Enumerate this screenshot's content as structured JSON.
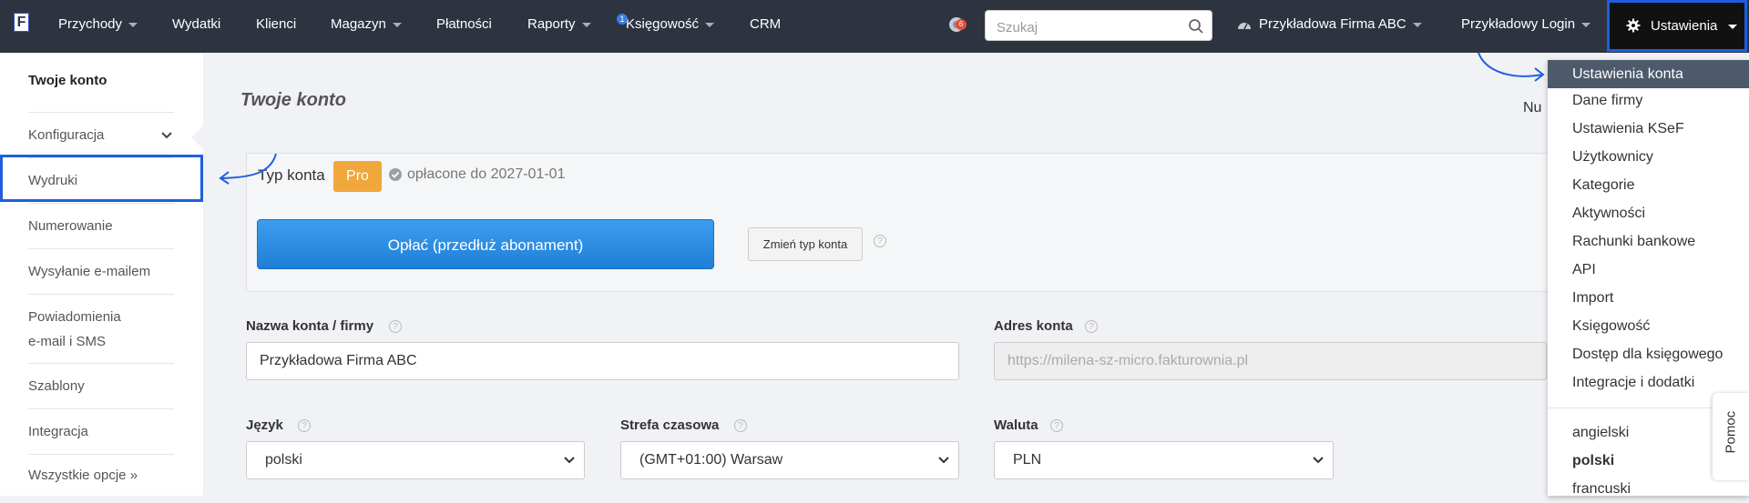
{
  "nav": {
    "logo": "F",
    "items": [
      {
        "label": "Przychody",
        "caret": true
      },
      {
        "label": "Wydatki",
        "caret": false
      },
      {
        "label": "Klienci",
        "caret": false
      },
      {
        "label": "Magazyn",
        "caret": true
      },
      {
        "label": "Płatności",
        "caret": false
      },
      {
        "label": "Raporty",
        "caret": true
      },
      {
        "label": "Księgowość",
        "caret": true,
        "badge": "1"
      },
      {
        "label": "CRM",
        "caret": false
      }
    ],
    "notification_count": "6",
    "search_placeholder": "Szukaj",
    "company": "Przykładowa Firma ABC",
    "login": "Przykładowy Login",
    "settings": "Ustawienia"
  },
  "sidebar": {
    "items": [
      {
        "label": "Twoje konto",
        "active": true
      },
      {
        "label": "Konfiguracja",
        "chevron": true
      },
      {
        "label": "Wydruki"
      },
      {
        "label": "Numerowanie"
      },
      {
        "label": "Wysyłanie e-mailem"
      },
      {
        "label": "Powiadomienia",
        "label2": "e-mail i SMS"
      },
      {
        "label": "Szablony"
      },
      {
        "label": "Integracja"
      },
      {
        "label": "Wszystkie opcje »"
      }
    ]
  },
  "main": {
    "title": "Twoje konto",
    "num_label": "Nu",
    "account_type_label": "Typ konta",
    "plan_badge": "Pro",
    "paid_until": "opłacone do 2027-01-01",
    "pay_button": "Opłać (przedłuż abonament)",
    "change_button": "Zmień typ konta",
    "help_mark": "?",
    "name_label": "Nazwa konta / firmy",
    "name_value": "Przykładowa Firma ABC",
    "address_label": "Adres konta",
    "address_placeholder": "https://milena-sz-micro.fakturownia.pl",
    "language_label": "Język",
    "language_value": "polski",
    "timezone_label": "Strefa czasowa",
    "timezone_value": "(GMT+01:00) Warsaw",
    "currency_label": "Waluta",
    "currency_value": "PLN"
  },
  "dropdown": {
    "items": [
      {
        "label": "Ustawienia konta",
        "active": true
      },
      {
        "label": "Dane firmy"
      },
      {
        "label": "Ustawienia KSeF"
      },
      {
        "label": "Użytkownicy"
      },
      {
        "label": "Kategorie"
      },
      {
        "label": "Aktywności"
      },
      {
        "label": "Rachunki bankowe"
      },
      {
        "label": "API"
      },
      {
        "label": "Import"
      },
      {
        "label": "Księgowość"
      },
      {
        "label": "Dostęp dla księgowego"
      },
      {
        "label": "Integracje i dodatki"
      }
    ],
    "languages": [
      {
        "label": "angielski"
      },
      {
        "label": "polski",
        "bold": true
      },
      {
        "label": "francuski"
      }
    ]
  },
  "help_tab": "Pomoc",
  "colors": {
    "navbar": "#2d3440",
    "accent": "#1f5fde",
    "pro": "#f0a73c",
    "pay": "#2b8ee6",
    "dropdown_active": "#4d5a6b"
  }
}
